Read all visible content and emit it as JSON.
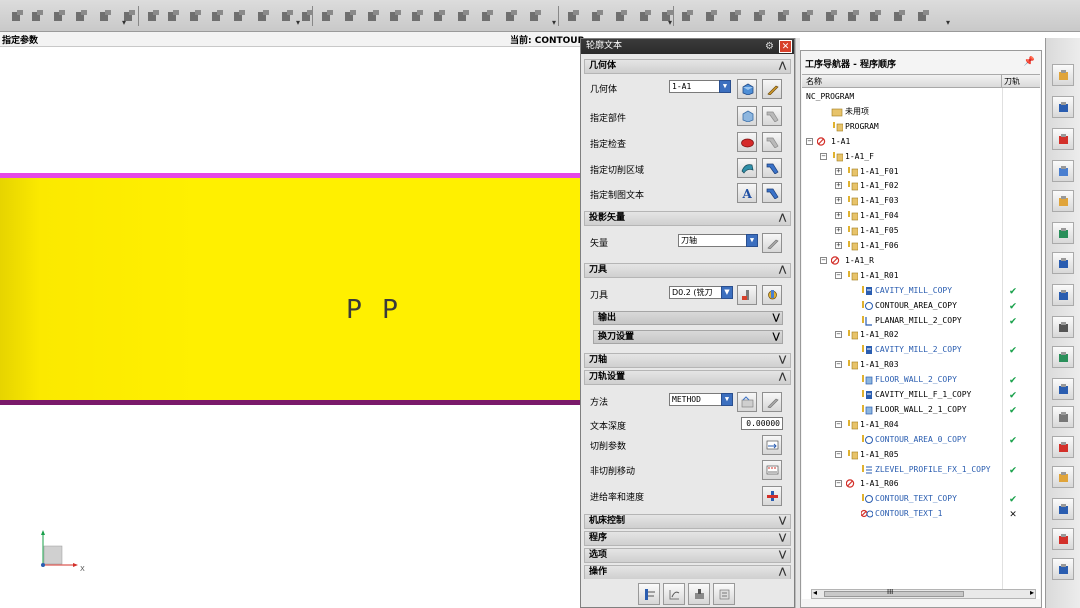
{
  "viewport": {
    "status_left": "指定参数",
    "status_right": "当前: CONTOUR",
    "model_text": "P P",
    "triad_x_label": "X"
  },
  "dialog": {
    "title": "轮廓文本",
    "close_glyph": "✕",
    "sections": {
      "geometry": {
        "label": "几何体"
      },
      "projection": {
        "label": "投影矢量"
      },
      "tool": {
        "label": "刀具"
      },
      "tool_axis": {
        "label": "刀轴"
      },
      "path_settings": {
        "label": "刀轨设置"
      },
      "machine_control": {
        "label": "机床控制"
      },
      "program": {
        "label": "程序"
      },
      "options": {
        "label": "选项"
      },
      "actions": {
        "label": "操作"
      }
    },
    "geometry": {
      "geometry_label": "几何体",
      "geometry_value": "1-A1",
      "specify_part": "指定部件",
      "specify_check": "指定检查",
      "specify_cut_area": "指定切削区域",
      "specify_drafting_text": "指定制图文本"
    },
    "projection": {
      "vector_label": "矢量",
      "vector_value": "刀轴"
    },
    "tool": {
      "tool_label": "刀具",
      "tool_value": "D0.2 (铣刀",
      "output_label": "输出",
      "tool_change_label": "换刀设置"
    },
    "path_settings": {
      "method_label": "方法",
      "method_value": "METHOD",
      "text_depth_label": "文本深度",
      "text_depth_value": "0.00000",
      "cutting_params": "切削参数",
      "non_cutting_moves": "非切削移动",
      "feeds_speeds": "进给率和速度"
    }
  },
  "navigator": {
    "title": "工序导航器 - 程序顺序",
    "col_name": "名称",
    "col_path": "刀轨",
    "rows": [
      {
        "label": "NC_PROGRAM",
        "level": 0,
        "type": "root",
        "exp": "",
        "status": "",
        "color": "normal"
      },
      {
        "label": "未用项",
        "level": 1,
        "type": "folder",
        "exp": "",
        "status": "",
        "color": "normal"
      },
      {
        "label": "PROGRAM",
        "level": 1,
        "type": "program",
        "exp": "",
        "status": "",
        "color": "normal"
      },
      {
        "label": "1-A1",
        "level": 0,
        "type": "program-bad",
        "exp": "−",
        "status": "",
        "color": "normal"
      },
      {
        "label": "1-A1_F",
        "level": 1,
        "type": "program",
        "exp": "−",
        "status": "",
        "color": "normal"
      },
      {
        "label": "1-A1_F01",
        "level": 2,
        "type": "program",
        "exp": "+",
        "status": "",
        "color": "normal"
      },
      {
        "label": "1-A1_F02",
        "level": 2,
        "type": "program",
        "exp": "+",
        "status": "",
        "color": "normal"
      },
      {
        "label": "1-A1_F03",
        "level": 2,
        "type": "program",
        "exp": "+",
        "status": "",
        "color": "normal"
      },
      {
        "label": "1-A1_F04",
        "level": 2,
        "type": "program",
        "exp": "+",
        "status": "",
        "color": "normal"
      },
      {
        "label": "1-A1_F05",
        "level": 2,
        "type": "program",
        "exp": "+",
        "status": "",
        "color": "normal"
      },
      {
        "label": "1-A1_F06",
        "level": 2,
        "type": "program",
        "exp": "+",
        "status": "",
        "color": "normal"
      },
      {
        "label": "1-A1_R",
        "level": 1,
        "type": "program-bad",
        "exp": "−",
        "status": "",
        "color": "normal"
      },
      {
        "label": "1-A1_R01",
        "level": 2,
        "type": "program",
        "exp": "−",
        "status": "",
        "color": "normal"
      },
      {
        "label": "CAVITY_MILL_COPY",
        "level": 3,
        "type": "op-cavity",
        "exp": "",
        "status": "✔",
        "color": "blue"
      },
      {
        "label": "CONTOUR_AREA_COPY",
        "level": 3,
        "type": "op-contour",
        "exp": "",
        "status": "✔",
        "color": "normal"
      },
      {
        "label": "PLANAR_MILL_2_COPY",
        "level": 3,
        "type": "op-planar",
        "exp": "",
        "status": "✔",
        "color": "normal"
      },
      {
        "label": "1-A1_R02",
        "level": 2,
        "type": "program",
        "exp": "−",
        "status": "",
        "color": "normal"
      },
      {
        "label": "CAVITY_MILL_2_COPY",
        "level": 3,
        "type": "op-cavity",
        "exp": "",
        "status": "✔",
        "color": "blue"
      },
      {
        "label": "1-A1_R03",
        "level": 2,
        "type": "program",
        "exp": "−",
        "status": "",
        "color": "normal"
      },
      {
        "label": "FLOOR_WALL_2_COPY",
        "level": 3,
        "type": "op-floor",
        "exp": "",
        "status": "✔",
        "color": "blue"
      },
      {
        "label": "CAVITY_MILL_F_1_COPY",
        "level": 3,
        "type": "op-cavity",
        "exp": "",
        "status": "✔",
        "color": "normal"
      },
      {
        "label": "FLOOR_WALL_2_1_COPY",
        "level": 3,
        "type": "op-floor",
        "exp": "",
        "status": "✔",
        "color": "normal"
      },
      {
        "label": "1-A1_R04",
        "level": 2,
        "type": "program",
        "exp": "−",
        "status": "",
        "color": "normal"
      },
      {
        "label": "CONTOUR_AREA_0_COPY",
        "level": 3,
        "type": "op-contour",
        "exp": "",
        "status": "✔",
        "color": "blue"
      },
      {
        "label": "1-A1_R05",
        "level": 2,
        "type": "program",
        "exp": "−",
        "status": "",
        "color": "normal"
      },
      {
        "label": "ZLEVEL_PROFILE_FX_1_COPY",
        "level": 3,
        "type": "op-zlevel",
        "exp": "",
        "status": "✔",
        "color": "blue"
      },
      {
        "label": "1-A1_R06",
        "level": 2,
        "type": "program-bad",
        "exp": "−",
        "status": "",
        "color": "normal"
      },
      {
        "label": "CONTOUR_TEXT_COPY",
        "level": 3,
        "type": "op-contour",
        "exp": "",
        "status": "✔",
        "color": "blue"
      },
      {
        "label": "CONTOUR_TEXT_1",
        "level": 3,
        "type": "op-contour-bad",
        "exp": "",
        "status": "✕",
        "color": "blue"
      }
    ],
    "scroll_center_label": "III"
  },
  "colors": {
    "slab_yellow": "#fff000",
    "slab_magenta": "#e548e5",
    "ok_green": "#18a04a",
    "op_blue": "#2a5db0",
    "bad_red": "#d3302a"
  }
}
